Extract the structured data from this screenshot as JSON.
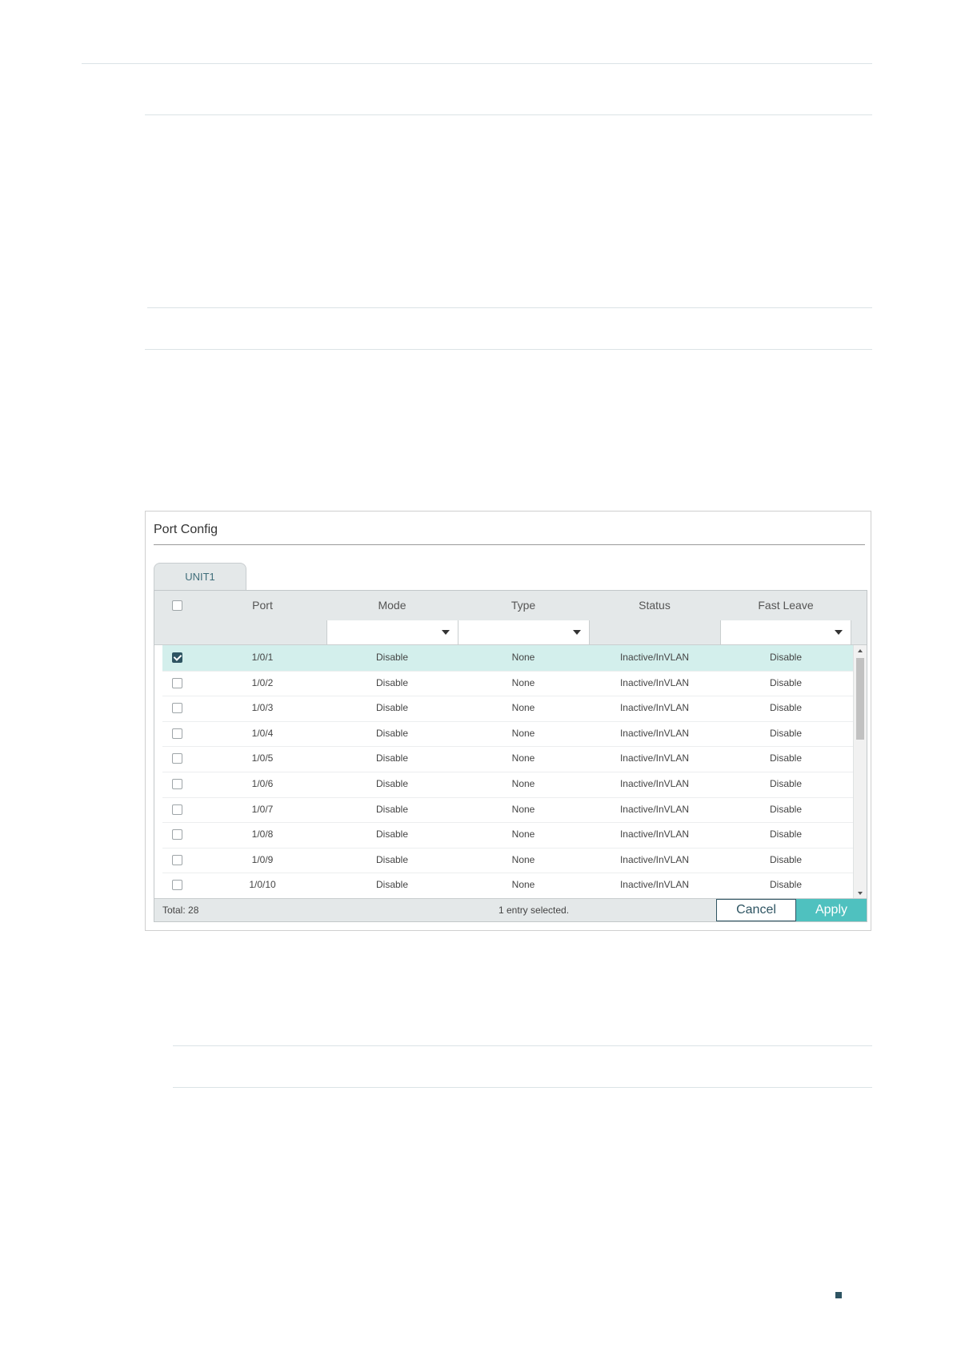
{
  "panel": {
    "title": "Port Config",
    "tab": "UNIT1"
  },
  "table": {
    "columns": [
      "Port",
      "Mode",
      "Type",
      "Status",
      "Fast Leave"
    ],
    "rows": [
      {
        "port": "1/0/1",
        "mode": "Disable",
        "type": "None",
        "status": "Inactive/InVLAN",
        "fast_leave": "Disable",
        "checked": true
      },
      {
        "port": "1/0/2",
        "mode": "Disable",
        "type": "None",
        "status": "Inactive/InVLAN",
        "fast_leave": "Disable",
        "checked": false
      },
      {
        "port": "1/0/3",
        "mode": "Disable",
        "type": "None",
        "status": "Inactive/InVLAN",
        "fast_leave": "Disable",
        "checked": false
      },
      {
        "port": "1/0/4",
        "mode": "Disable",
        "type": "None",
        "status": "Inactive/InVLAN",
        "fast_leave": "Disable",
        "checked": false
      },
      {
        "port": "1/0/5",
        "mode": "Disable",
        "type": "None",
        "status": "Inactive/InVLAN",
        "fast_leave": "Disable",
        "checked": false
      },
      {
        "port": "1/0/6",
        "mode": "Disable",
        "type": "None",
        "status": "Inactive/InVLAN",
        "fast_leave": "Disable",
        "checked": false
      },
      {
        "port": "1/0/7",
        "mode": "Disable",
        "type": "None",
        "status": "Inactive/InVLAN",
        "fast_leave": "Disable",
        "checked": false
      },
      {
        "port": "1/0/8",
        "mode": "Disable",
        "type": "None",
        "status": "Inactive/InVLAN",
        "fast_leave": "Disable",
        "checked": false
      },
      {
        "port": "1/0/9",
        "mode": "Disable",
        "type": "None",
        "status": "Inactive/InVLAN",
        "fast_leave": "Disable",
        "checked": false
      },
      {
        "port": "1/0/10",
        "mode": "Disable",
        "type": "None",
        "status": "Inactive/InVLAN",
        "fast_leave": "Disable",
        "checked": false
      }
    ]
  },
  "footer": {
    "total": "Total: 28",
    "selected": "1 entry selected.",
    "cancel_label": "Cancel",
    "apply_label": "Apply"
  },
  "colors": {
    "accent": "#4fc1bf",
    "selected_row": "#d3efec",
    "dark": "#2e5462"
  }
}
